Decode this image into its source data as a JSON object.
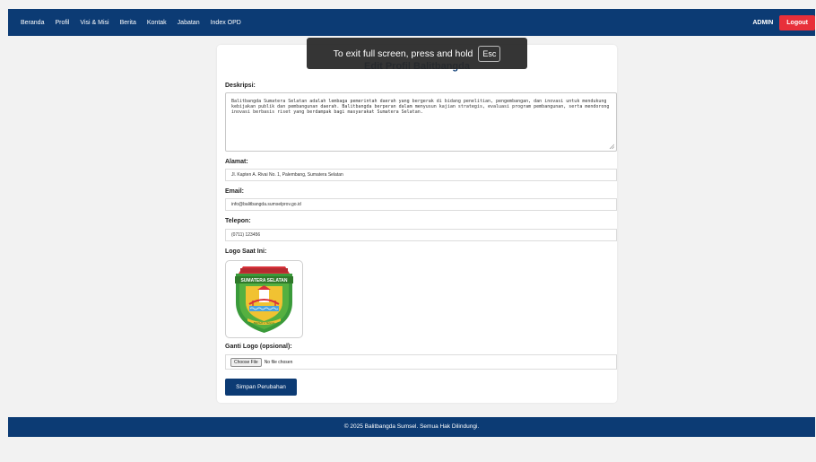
{
  "nav": {
    "links": [
      "Beranda",
      "Profil",
      "Visi & Misi",
      "Berita",
      "Kontak",
      "Jabatan",
      "Index OPD"
    ],
    "admin_label": "ADMIN",
    "logout_label": "Logout"
  },
  "card": {
    "title": "Edit Profil Balitbangda",
    "deskripsi_label": "Deskripsi:",
    "deskripsi_value": "Balitbangda Sumatera Selatan adalah lembaga pemerintah daerah yang bergerak di bidang penelitian, pengembangan, dan inovasi untuk mendukung kebijakan publik dan pembangunan daerah. Balitbangda berperan dalam menyusun kajian strategis, evaluasi program pembangunan, serta mendorong inovasi berbasis riset yang berdampak bagi masyarakat Sumatera Selatan.",
    "alamat_label": "Alamat:",
    "alamat_value": "Jl. Kapten A. Rivai No. 1, Palembang, Sumatera Selatan",
    "email_label": "Email:",
    "email_value": "info@balitbangda.sumselprov.go.id",
    "telepon_label": "Telepon:",
    "telepon_value": "(0711) 123456",
    "logo_label": "Logo Saat Ini:",
    "logo_banner_text": "SUMATERA SELATAN",
    "logo_motto_text": "BERSATU TEGUH",
    "ganti_logo_label": "Ganti Logo (opsional):",
    "choose_file_label": "Choose File",
    "no_file_text": "No file chosen",
    "save_label": "Simpan Perubahan"
  },
  "footer": {
    "text": "© 2025 Balitbangda Sumsel. Semua Hak Dilindungi."
  },
  "fullscreen_toast": {
    "text": "To exit full screen, press and hold",
    "key": "Esc"
  },
  "colors": {
    "primary": "#0c3b74",
    "logout": "#e8303a",
    "background": "#f2f2f2"
  }
}
